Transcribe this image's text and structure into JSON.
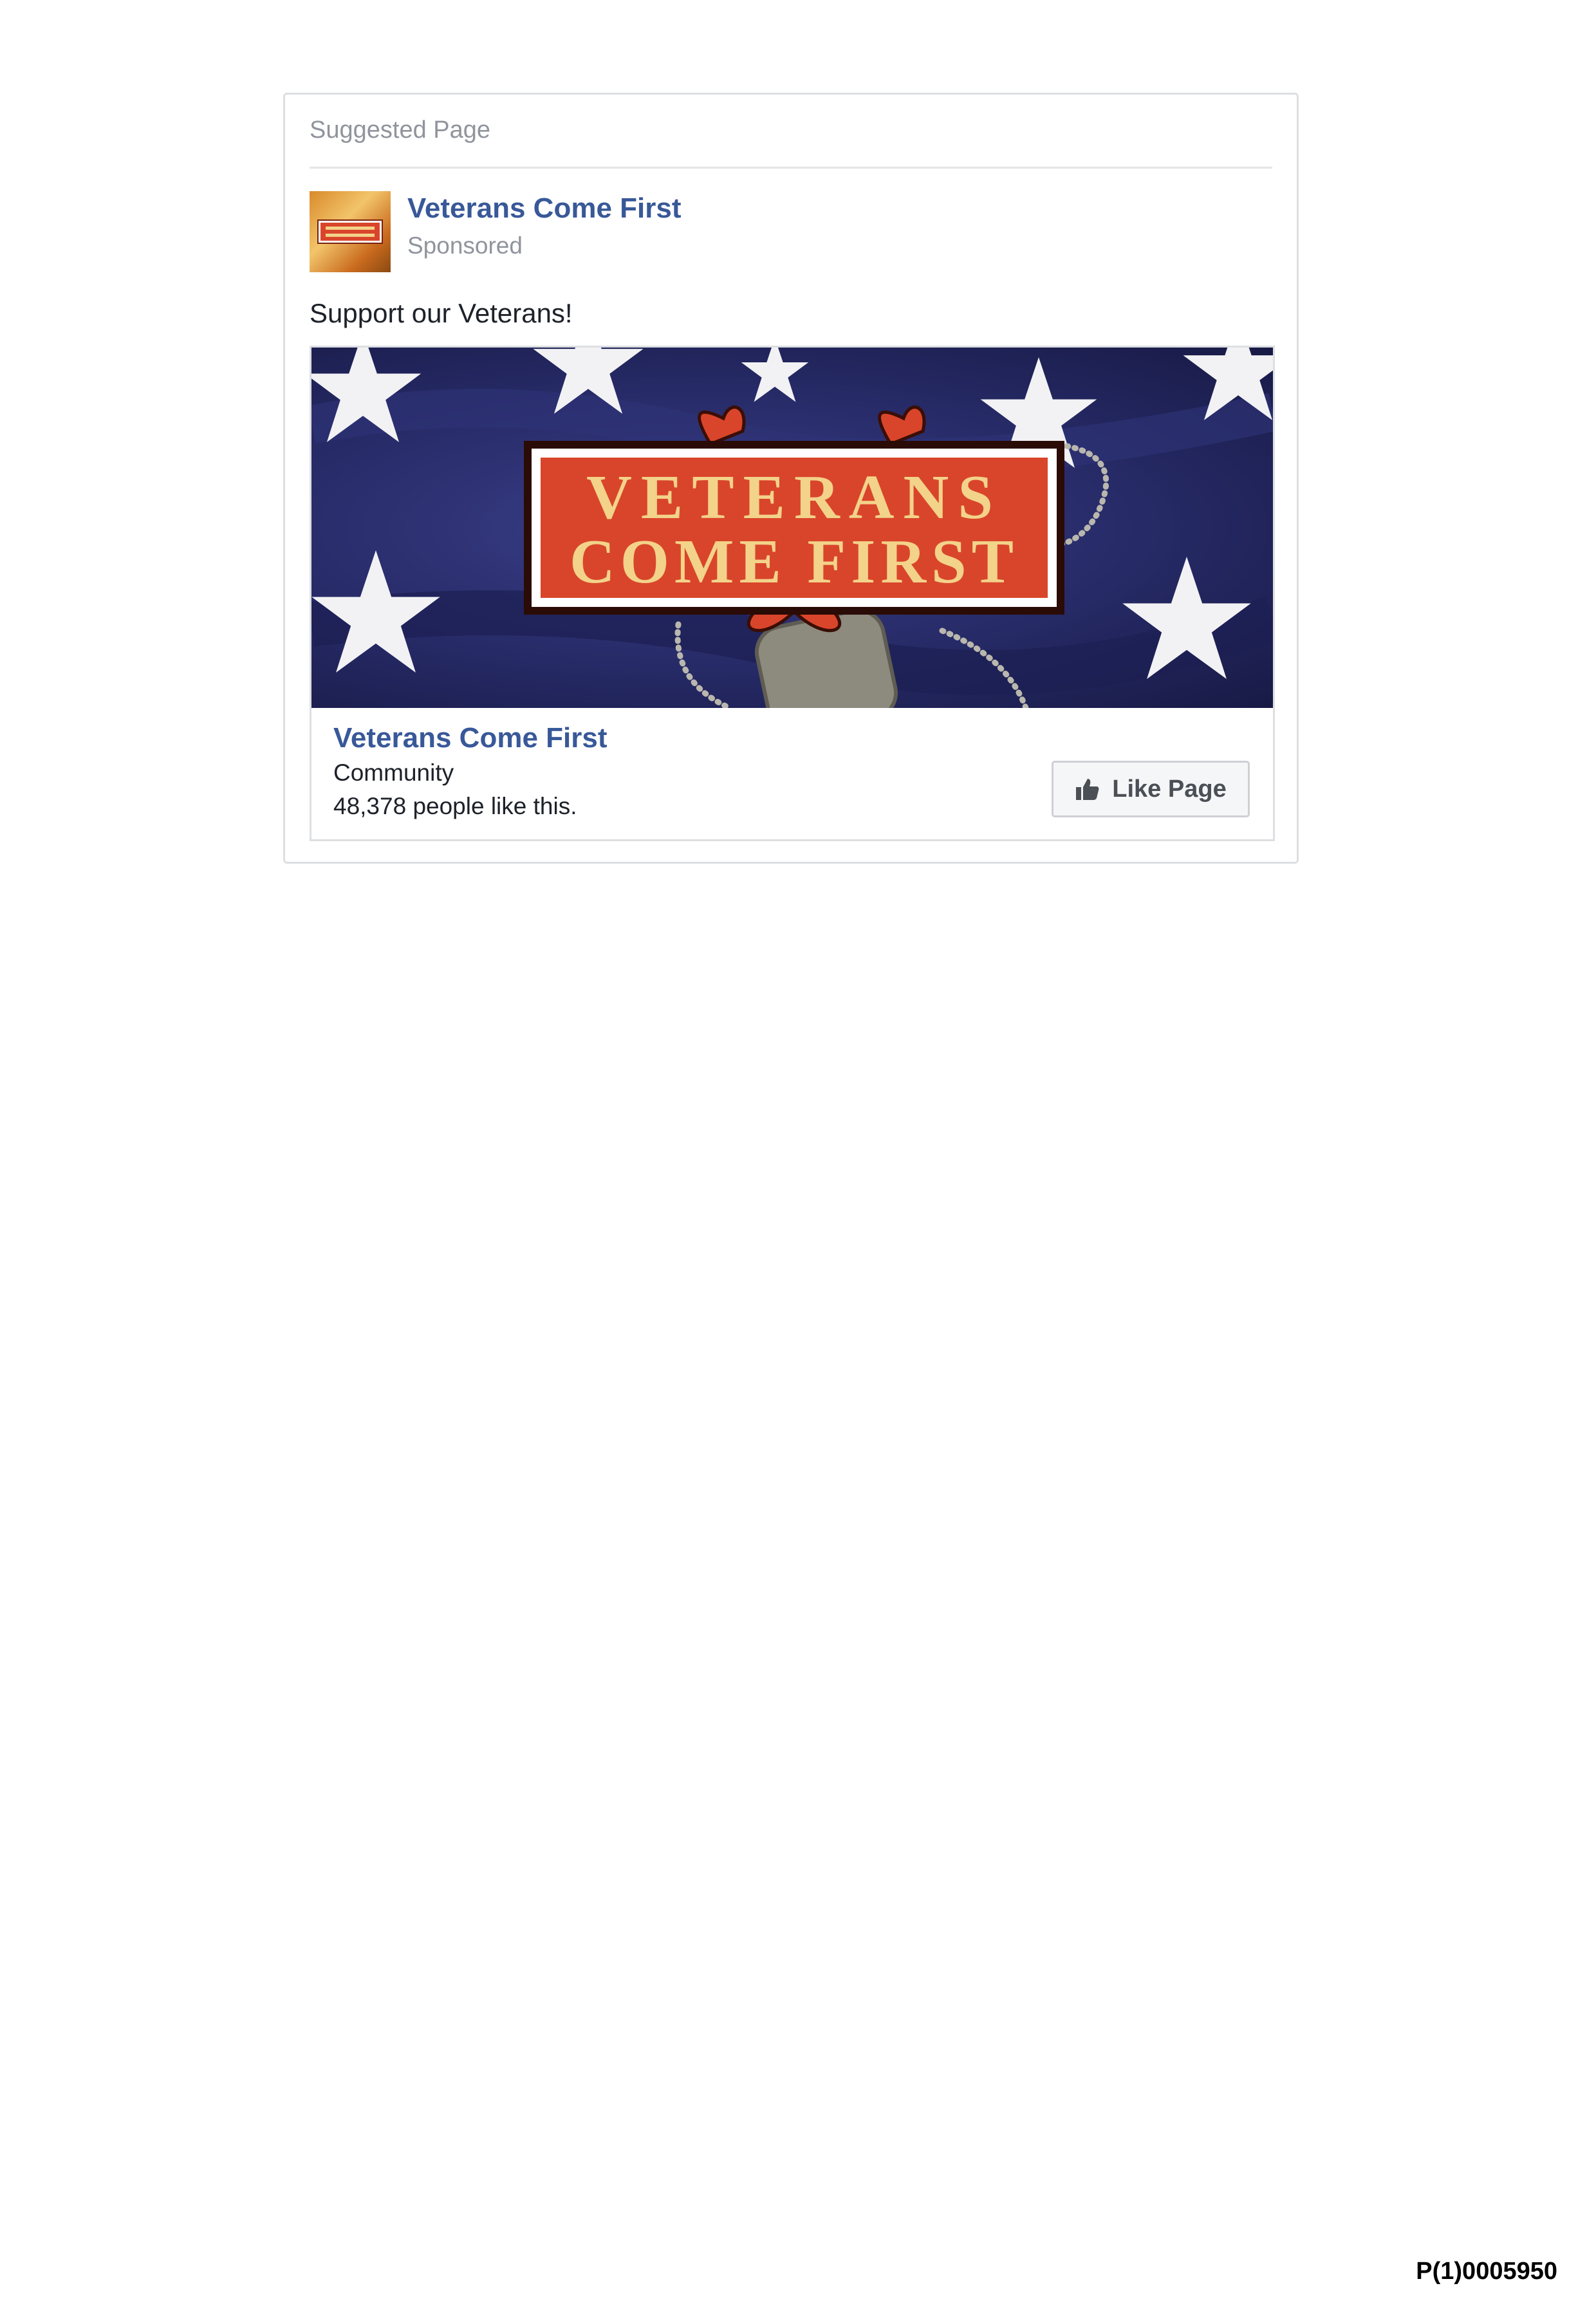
{
  "card": {
    "header": "Suggested Page",
    "page_name": "Veterans Come First",
    "sponsored_label": "Sponsored",
    "post_text": "Support our Veterans!"
  },
  "attachment": {
    "cover_logo": {
      "line1": "VETERANS",
      "line2": "COME FIRST"
    },
    "title": "Veterans Come First",
    "category": "Community",
    "likes_text": "48,378 people like this.",
    "like_button_label": "Like Page",
    "like_icon": "thumbs-up-icon"
  },
  "footer": {
    "document_id": "P(1)0005950"
  },
  "colors": {
    "link_blue": "#385898",
    "muted_text": "#90949c",
    "flag_navy": "#262a66",
    "logo_red": "#d9452b",
    "logo_gold": "#f3d28a"
  }
}
